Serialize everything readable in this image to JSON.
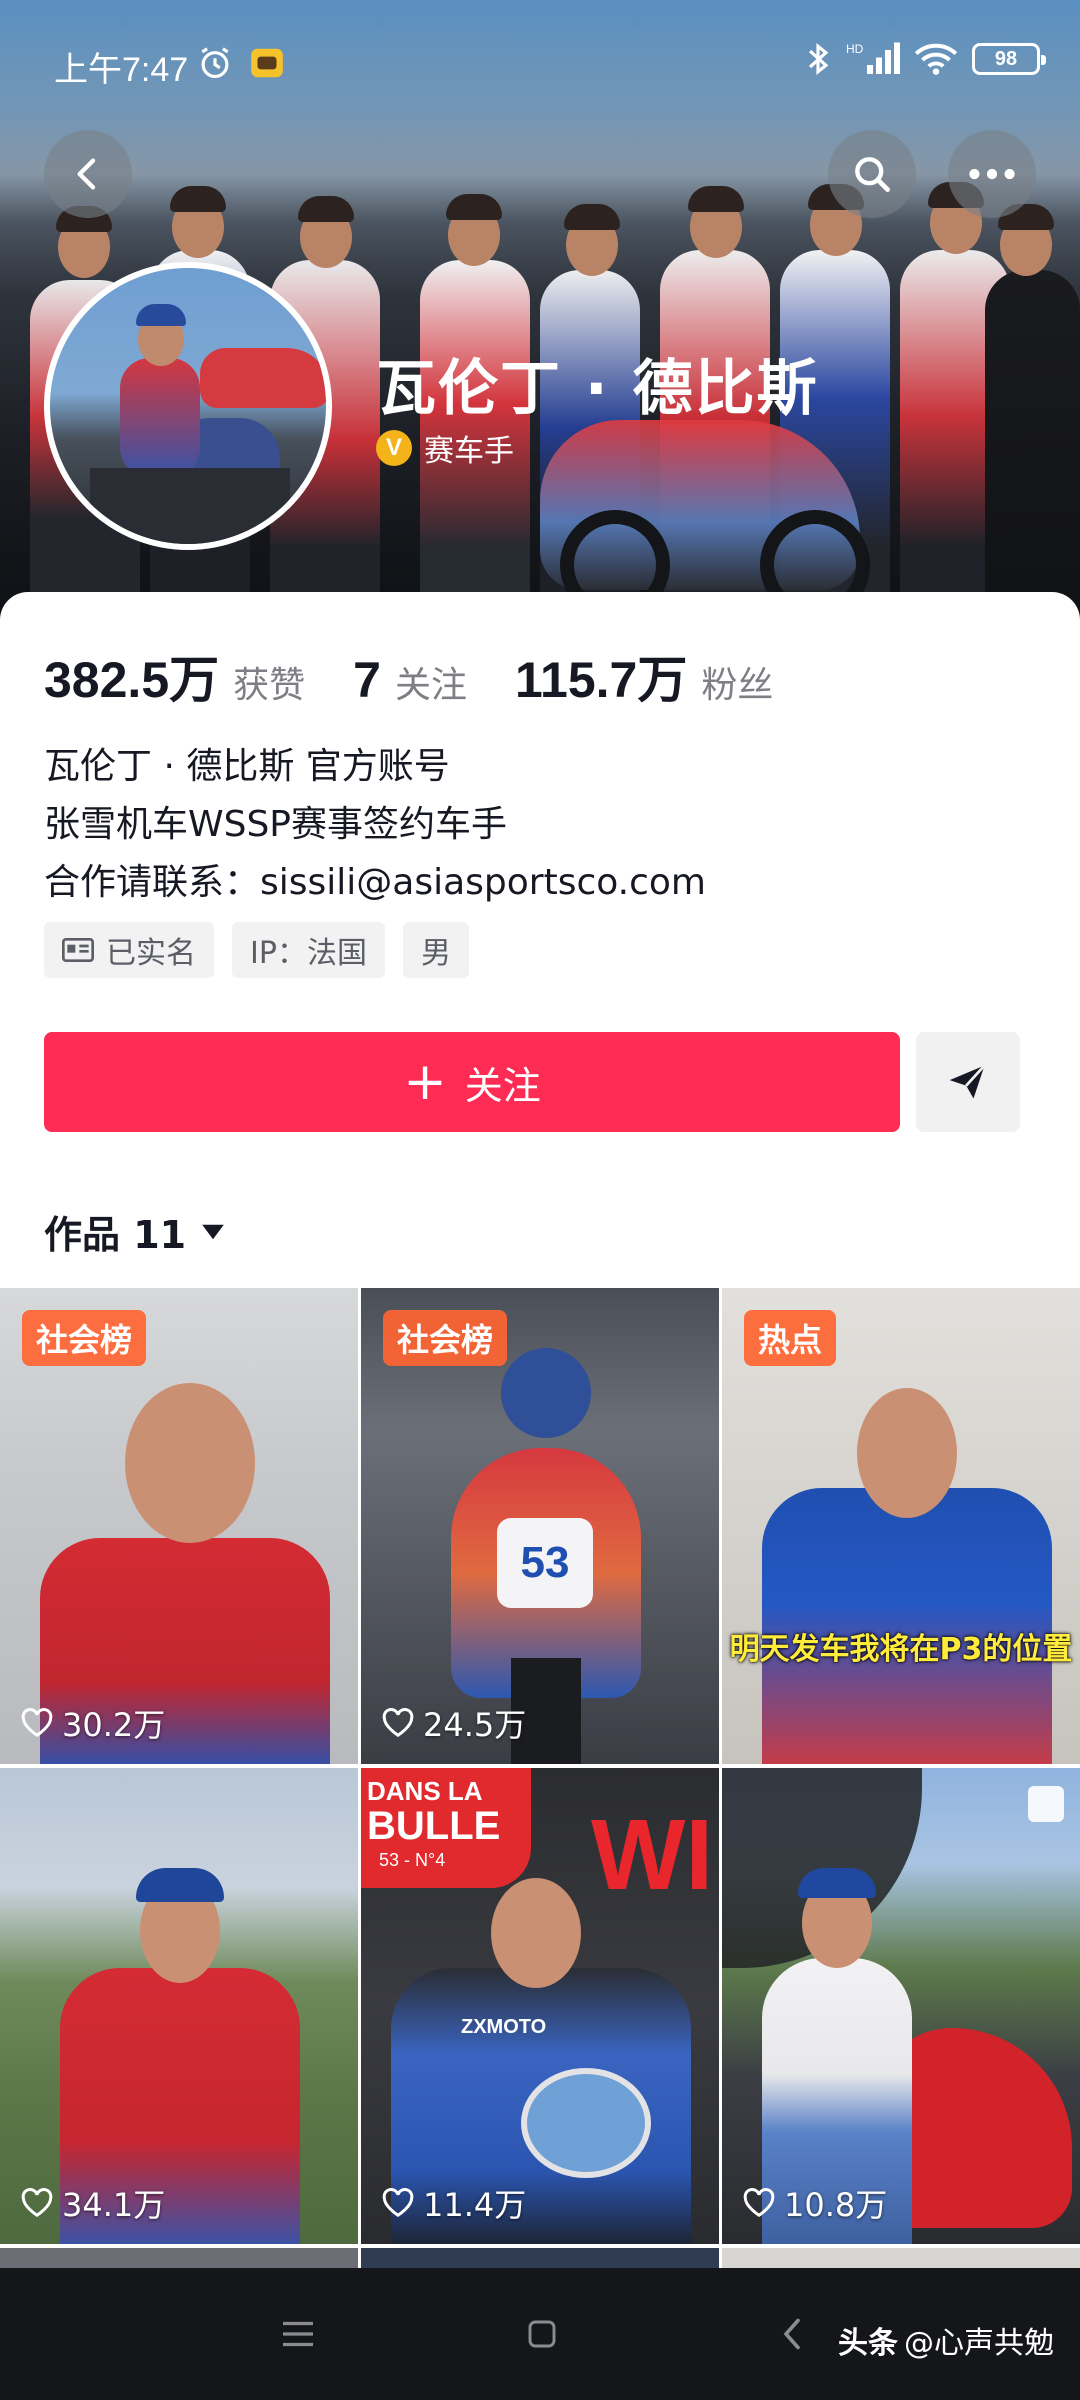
{
  "status_bar": {
    "time": "上午7:47",
    "battery": "98"
  },
  "profile": {
    "name": "瓦伦丁 · 德比斯",
    "verified_label": "赛车手",
    "verified_badge": "V"
  },
  "stats": [
    {
      "value": "382.5万",
      "label": "获赞"
    },
    {
      "value": "7",
      "label": "关注"
    },
    {
      "value": "115.7万",
      "label": "粉丝"
    }
  ],
  "bio": {
    "line1": "瓦伦丁 · 德比斯 官方账号",
    "line2": "张雪机车WSSP赛事签约车手",
    "line3": "合作请联系：sissili@asiasportsco.com"
  },
  "tags": [
    {
      "text": "已实名",
      "icon": "id-card-icon"
    },
    {
      "text": "IP：法国"
    },
    {
      "text": "男"
    }
  ],
  "actions": {
    "follow_label": "关注",
    "follow_icon": "+"
  },
  "works": {
    "label": "作品 11"
  },
  "videos": [
    {
      "badge": "社会榜",
      "likes": "30.2万"
    },
    {
      "badge": "社会榜",
      "likes": "24.5万"
    },
    {
      "badge": "热点",
      "likes": "",
      "caption": "明天发车我将在P3的位置"
    },
    {
      "badge": "",
      "likes": "34.1万"
    },
    {
      "badge": "",
      "likes": "11.4万"
    },
    {
      "badge": "",
      "likes": "10.8万"
    }
  ],
  "video_texts": {
    "v2_number": "53",
    "v5_banner_1": "DANS LA",
    "v5_banner_2": "BULLE",
    "v5_banner_3": "53 - N°4",
    "v5_win": "WI",
    "v5_brand": "ZXMOTO"
  },
  "watermark": {
    "brand": "头条",
    "handle": "@心声共勉"
  },
  "colors": {
    "primary": "#fe2c55",
    "badge": "#ff6432",
    "verified": "#f4b318"
  }
}
